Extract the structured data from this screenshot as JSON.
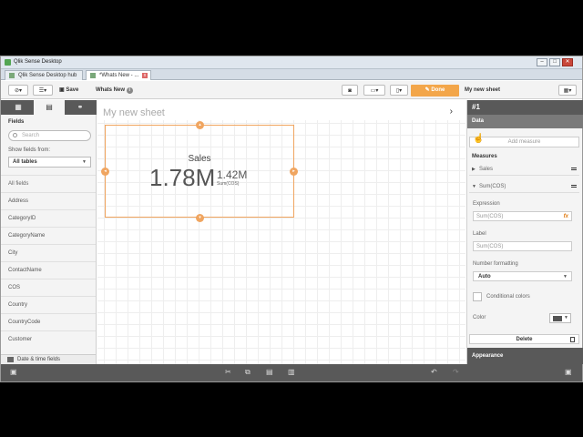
{
  "window": {
    "title": "Qlik Sense Desktop",
    "controls": [
      "–",
      "□",
      "✕"
    ]
  },
  "tabs": [
    {
      "label": "Qlik Sense Desktop hub",
      "active": false
    },
    {
      "label": "*Whats New - ...",
      "active": true
    }
  ],
  "toolbar": {
    "save_label": "Save",
    "app_name": "Whats New",
    "done_label": "Done",
    "sheet_name": "My new sheet"
  },
  "sidebar": {
    "fields_title": "Fields",
    "search_placeholder": "Search",
    "show_from_label": "Show fields from:",
    "show_from_value": "All tables",
    "all_fields": "All fields",
    "fields": [
      "Address",
      "CategoryID",
      "CategoryName",
      "City",
      "ContactName",
      "COS",
      "Country",
      "CountryCode",
      "Customer"
    ],
    "date_time_fields": "Date & time fields"
  },
  "canvas": {
    "sheet_title": "My new sheet",
    "kpi": {
      "label": "Sales",
      "main_value": "1.78M",
      "secondary_value": "1.42M",
      "secondary_label": "Sum(COS)"
    }
  },
  "properties": {
    "id": "#1",
    "section_data": "Data",
    "add_measure": "Add measure",
    "measures_title": "Measures",
    "measures": [
      {
        "label": "Sales",
        "expanded": false
      },
      {
        "label": "Sum(COS)",
        "expanded": true
      }
    ],
    "expression_label": "Expression",
    "expression_value": "Sum(COS)",
    "label_label": "Label",
    "label_placeholder": "Sum(COS)",
    "number_formatting_label": "Number formatting",
    "number_formatting_value": "Auto",
    "conditional_colors_label": "Conditional colors",
    "color_label": "Color",
    "delete_label": "Delete",
    "appearance_label": "Appearance"
  },
  "colors": {
    "accent": "#f3a64a",
    "selection_border": "#f0a560",
    "dark_panel": "#595959"
  }
}
